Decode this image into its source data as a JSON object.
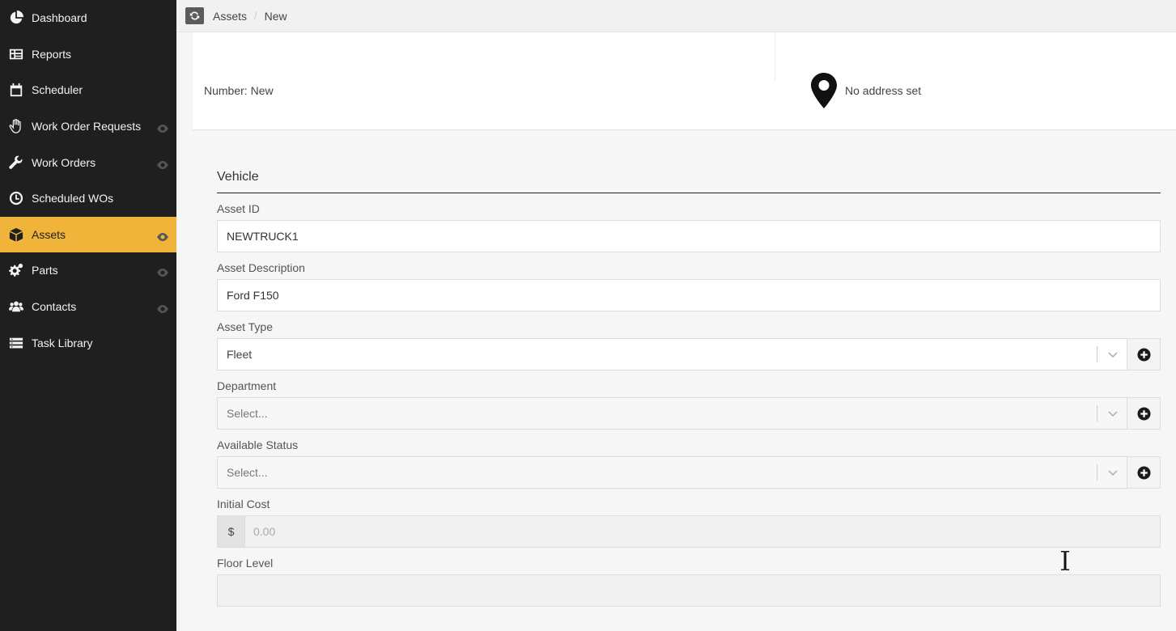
{
  "sidebar": {
    "items": [
      {
        "label": "Dashboard",
        "icon": "pie-chart-icon",
        "eye": false,
        "active": false
      },
      {
        "label": "Reports",
        "icon": "table-icon",
        "eye": false,
        "active": false
      },
      {
        "label": "Scheduler",
        "icon": "calendar-icon",
        "eye": false,
        "active": false
      },
      {
        "label": "Work Order Requests",
        "icon": "hand-icon",
        "eye": true,
        "active": false
      },
      {
        "label": "Work Orders",
        "icon": "wrench-icon",
        "eye": true,
        "active": false
      },
      {
        "label": "Scheduled WOs",
        "icon": "clock-icon",
        "eye": false,
        "active": false
      },
      {
        "label": "Assets",
        "icon": "cube-icon",
        "eye": true,
        "active": true
      },
      {
        "label": "Parts",
        "icon": "gears-icon",
        "eye": true,
        "active": false
      },
      {
        "label": "Contacts",
        "icon": "users-icon",
        "eye": true,
        "active": false
      },
      {
        "label": "Task Library",
        "icon": "list-icon",
        "eye": false,
        "active": false
      }
    ],
    "active_color": "#f0b43a",
    "background": "#1f1f1f"
  },
  "breadcrumb": {
    "items": [
      "Assets",
      "New"
    ]
  },
  "header": {
    "number_label": "Number:",
    "number_value": "New",
    "address_text": "No address set"
  },
  "form": {
    "section_title": "Vehicle",
    "asset_id": {
      "label": "Asset ID",
      "value": "NEWTRUCK1"
    },
    "asset_description": {
      "label": "Asset Description",
      "value": "Ford F150"
    },
    "asset_type": {
      "label": "Asset Type",
      "value": "Fleet"
    },
    "department": {
      "label": "Department",
      "value": "Select..."
    },
    "available_status": {
      "label": "Available Status",
      "value": "Select..."
    },
    "initial_cost": {
      "label": "Initial Cost",
      "prefix": "$",
      "placeholder": "0.00"
    },
    "floor_level": {
      "label": "Floor Level",
      "value": ""
    }
  }
}
